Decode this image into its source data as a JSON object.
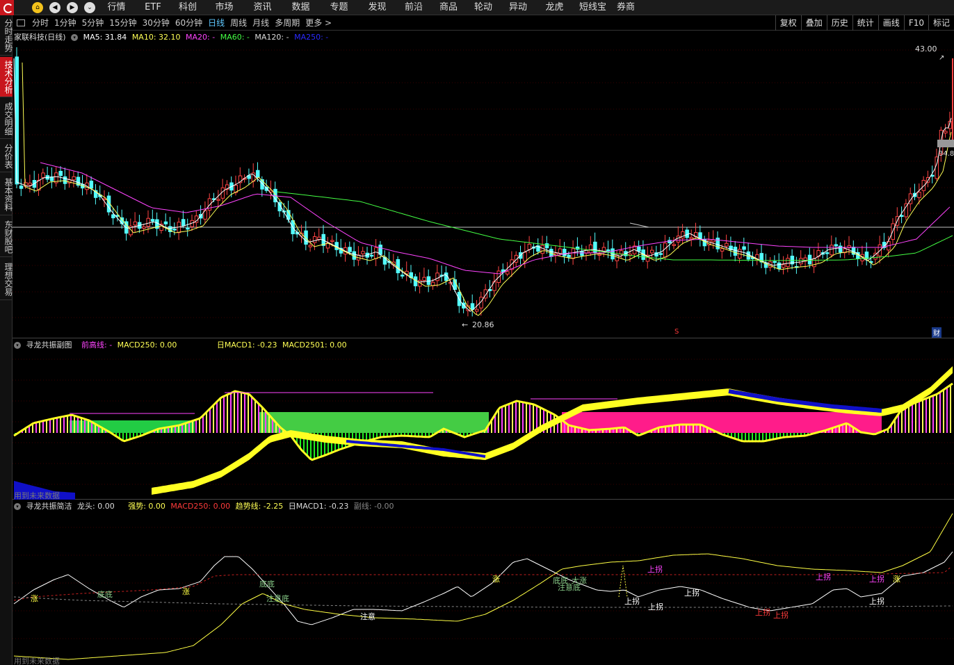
{
  "nav": {
    "menu": [
      "行情",
      "ETF",
      "科创",
      "市场",
      "资讯",
      "数据",
      "专题",
      "发现",
      "前沿",
      "商品",
      "轮动",
      "异动",
      "龙虎",
      "短线宝",
      "券商"
    ]
  },
  "left_tabs": [
    "分时走势",
    "技术分析",
    "成交明细",
    "分价表",
    "基本资料",
    "东财股吧",
    "理想交易"
  ],
  "period_bar": {
    "periods": [
      "分时",
      "1分钟",
      "5分钟",
      "15分钟",
      "30分钟",
      "60分钟",
      "日线",
      "周线",
      "月线",
      "多周期",
      "更多 >"
    ],
    "active_period": "日线",
    "tools": [
      "复权",
      "叠加",
      "历史",
      "统计",
      "画线",
      "F10",
      "标记"
    ]
  },
  "main_panel": {
    "stock": "家联科技(日线)",
    "ma5": "MA5: 31.84",
    "ma10": "MA10: 32.10",
    "ma20": "MA20: -",
    "ma60": "MA60: -",
    "ma120": "MA120: -",
    "ma250": "MA250: -",
    "high_label": "43.00",
    "low_label": "20.86",
    "price_marker": "34.8",
    "event_s": "S",
    "event_cai": "财"
  },
  "macd_panel": {
    "title": "寻龙共振副图",
    "qgx": "前高线: -",
    "macd250": "MACD250: 0.00",
    "rimacd1": "日MACD1: -0.23",
    "macd2501": "MACD2501: 0.00",
    "footer": "用到未来数据"
  },
  "xl_panel": {
    "title": "寻龙共振简洁",
    "longtou": "龙头: 0.00",
    "qiangshi": "强势: 0.00",
    "macd250": "MACD250: 0.00",
    "qushi": "趋势线: -2.25",
    "rimacd1": "日MACD1: -0.23",
    "fuxian": "副线: -0.00",
    "footer": "用到未来数据",
    "signals": [
      "涨",
      "底底",
      "涨",
      "底底",
      "注意底",
      "注意",
      "涨",
      "底底",
      "注意底",
      "大涨",
      "上拐",
      "上拐",
      "上拐",
      "上拐",
      "上拐",
      "上拐",
      "上拐",
      "上拐",
      "上拐",
      "涨"
    ]
  },
  "colors": {
    "up": "#ff4444",
    "down": "#54ffff",
    "ma5": "#ffffff",
    "ma10": "#ffff55",
    "ma20": "#ff44ff",
    "ma60": "#44ff44",
    "ma250": "#2020ff"
  }
}
